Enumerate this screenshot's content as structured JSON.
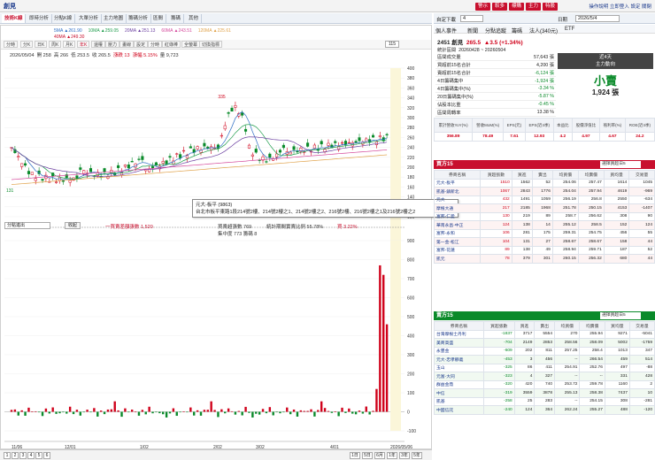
{
  "window": {
    "title": "創見"
  },
  "top_buttons": [
    "警示",
    "較多",
    "標購",
    "主力",
    "特股"
  ],
  "top_links": "操作說明 立即登入 設定 關閉",
  "chart_tabs": [
    "技術K線",
    "即時分析",
    "分點K線",
    "大單分析",
    "主力地圖",
    "籌碼分析",
    "區間",
    "籌碼",
    "其他"
  ],
  "toolbar_tabs": [
    "分時",
    "分K",
    "日K",
    "周K",
    "月K",
    "年K",
    "還權",
    "壓力",
    "畫線",
    "設定",
    "分時",
    "紅綠棒",
    "全螢幕",
    "切換指標"
  ],
  "period_input": "115",
  "ohlc_line": {
    "date": "2026/05/04",
    "open": "開 258",
    "high": "高 266",
    "low": "低 253.5",
    "close": "收 265.5",
    "change": "漲跌 13",
    "pct": "漲幅 5.15%",
    "vol": "量 9,723"
  },
  "ma_legend": [
    {
      "label": "5MA ▲261.90",
      "color": "#2b6cc4"
    },
    {
      "label": "10MA ▲259.05",
      "color": "#1e9c4b"
    },
    {
      "label": "20MA ▲251.13",
      "color": "#6b3fa0"
    },
    {
      "label": "60MA ▲243.51",
      "color": "#d4489b"
    },
    {
      "label": "120MA ▲225.61",
      "color": "#e0a24a"
    },
    {
      "label": "40MA ▲249.30",
      "color": "#c8102e"
    }
  ],
  "chart_data": {
    "type": "line",
    "price_axis": [
      "400",
      "380",
      "360",
      "340",
      "320",
      "300",
      "280",
      "260",
      "240",
      "220",
      "200",
      "180",
      "160",
      "140",
      "120",
      "100"
    ],
    "sub_axis": [
      "900",
      "800",
      "700",
      "600",
      "500",
      "400",
      "300",
      "200",
      "100",
      "0",
      "-100"
    ],
    "x_labels": [
      "11/06",
      "12/01",
      "1/02",
      "2/02",
      "3/02",
      "4/01",
      "2026/05/06"
    ],
    "year_label": "2026",
    "peak_label": "335",
    "low_label": "131"
  },
  "sub_panel": {
    "indicator": "分點進出",
    "btn": "收起",
    "label1": "一買賣差額張數 1,520",
    "label2": "買賣超張數 769",
    "label3": "集中度 773 籌碼 8",
    "label4": "統計期間實賣比例 55.78%",
    "label5": "買 3.22%"
  },
  "tooltip": {
    "line1": "元大-板平 (9863)",
    "line2": "台北市板平東路1段214號2樓、214號2樓之1、214號2樓之2、216號2樓、216號2樓之1及216號2樓之2"
  },
  "pagination": {
    "pages": [
      "1",
      "2",
      "3",
      "4",
      "5",
      "6"
    ],
    "buttons": [
      "1日",
      "5日",
      "6月",
      "1年",
      "3年",
      "5年"
    ]
  },
  "right": {
    "stock_label": "自定下載",
    "stock_input": "4",
    "date_label": "日期",
    "date_value": "2026/5/4",
    "tabs": [
      "基本資料",
      "新聞",
      "分點",
      "申報條款",
      "法人投資",
      "ETF"
    ],
    "sub_tabs": [
      "個人事件",
      "新聞",
      "分點追蹤",
      "籌碼",
      "法人(340元)",
      "ETF"
    ],
    "stock_name": "2451 創見",
    "stock_price": "265.5",
    "stock_change": "▲3.5 (+1.34%)",
    "range_label": "統計區間",
    "range_value": "20260428 ~ 20260504",
    "kv": [
      {
        "k": "區間成交量",
        "v": "57,643 張"
      },
      {
        "k": "買超前15名合計",
        "v": "4,200 張"
      },
      {
        "k": "賣超前15名合計",
        "v": "-6,124 張"
      },
      {
        "k": "4日籌碼集中",
        "v": "-1,924 張"
      },
      {
        "k": "4日籌碼集中(%)",
        "v": "-3.34 %"
      },
      {
        "k": "20日籌碼集中(%)",
        "v": "-5.87 %"
      },
      {
        "k": "佔股本比重",
        "v": "-0.45 %"
      },
      {
        "k": "區間周轉率",
        "v": "13.38 %"
      }
    ],
    "trend_title1": "近4天",
    "trend_title2": "主力動向",
    "trend_value": "小賣",
    "trend_qty": "1,924 張",
    "metrics_head": [
      "累計營收YoY(%)",
      "營收MoM(%)",
      "EPS(元)",
      "EPS(近4季)",
      "本益比",
      "股價淨值比",
      "殖利率(%)",
      "ROE(近4季)"
    ],
    "metrics": [
      "356.89",
      "78.49",
      "7.61",
      "12.93",
      "4.2",
      "4.97",
      "4.67",
      "24.2"
    ],
    "buy_title": "買方15",
    "sell_title": "賣方15",
    "broker_select": "選擇買超日5",
    "grid_head": [
      "券商名稱",
      "買超張數",
      "買進",
      "賣出",
      "均買價",
      "均賣價",
      "買均量",
      "交易量"
    ],
    "buy_rows": [
      [
        "元大-板平",
        "1510",
        "1562",
        "52",
        "254.06",
        "257.47",
        "1614",
        "1045"
      ],
      [
        "凱基-鎮新北",
        "1067",
        "2843",
        "1776",
        "254.04",
        "257.94",
        "4619",
        "-969"
      ],
      [
        "元大",
        "432",
        "1491",
        "1059",
        "256.19",
        "256.8",
        "2550",
        "-634"
      ],
      [
        "摩根大通",
        "217",
        "2185",
        "1968",
        "251.78",
        "250.15",
        "4153",
        "-1407"
      ],
      [
        "富邦-仁愛",
        "130",
        "219",
        "89",
        "258.7",
        "256.62",
        "308",
        "90"
      ],
      [
        "華南永昌-中正",
        "124",
        "138",
        "14",
        "255.12",
        "258.5",
        "152",
        "124"
      ],
      [
        "富邦-永和",
        "106",
        "281",
        "175",
        "259.31",
        "254.75",
        "456",
        "55"
      ],
      [
        "第一金-松江",
        "104",
        "131",
        "27",
        "258.67",
        "258.67",
        "158",
        "44"
      ],
      [
        "富邦-花蓮",
        "89",
        "138",
        "49",
        "258.94",
        "259.71",
        "187",
        "52"
      ],
      [
        "凱元",
        "78",
        "379",
        "301",
        "260.15",
        "256.32",
        "680",
        "44"
      ]
    ],
    "sell_rows": [
      [
        "台灣摩根士丹利",
        "-1837",
        "3717",
        "5554",
        "270",
        "255.94",
        "9271",
        "-5041"
      ],
      [
        "美商高盛",
        "-704",
        "2149",
        "2853",
        "258.56",
        "258.09",
        "5002",
        "-1759"
      ],
      [
        "永豐金",
        "-609",
        "202",
        "811",
        "257.25",
        "258.4",
        "1013",
        "347"
      ],
      [
        "元大-忠孝靜義",
        "-453",
        "3",
        "456",
        "--",
        "266.54",
        "459",
        "514"
      ],
      [
        "玉山",
        "-325",
        "86",
        "411",
        "254.91",
        "252.76",
        "497",
        "-88"
      ],
      [
        "元富-大同",
        "-323",
        "4",
        "327",
        "--",
        "--",
        "331",
        "428"
      ],
      [
        "群益金鼎",
        "-320",
        "420",
        "740",
        "253.72",
        "259.78",
        "1160",
        "2"
      ],
      [
        "中信",
        "-319",
        "3559",
        "3878",
        "255.13",
        "258.38",
        "7437",
        "10"
      ],
      [
        "凱基",
        "-258",
        "25",
        "283",
        "--",
        "254.15",
        "308",
        "-281"
      ],
      [
        "中國信託",
        "-240",
        "124",
        "364",
        "262.24",
        "255.27",
        "488",
        "-120"
      ]
    ]
  }
}
